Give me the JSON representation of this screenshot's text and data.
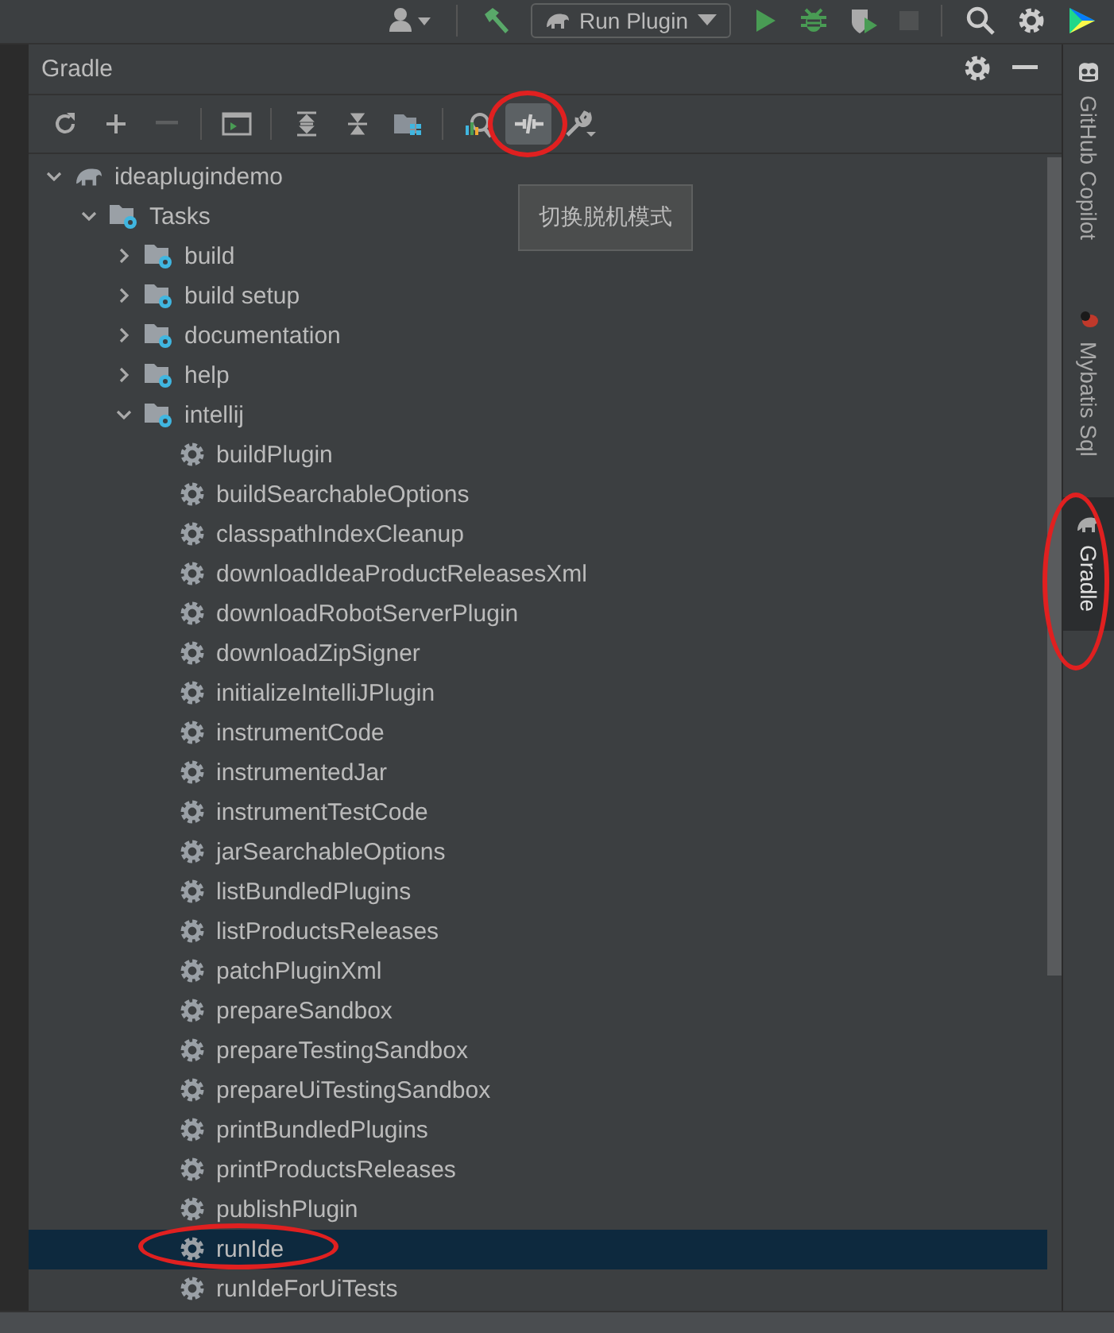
{
  "top_toolbar": {
    "run_configuration": "Run Plugin",
    "buttons": [
      {
        "kind": "user",
        "disabled": false
      },
      {
        "kind": "hammer",
        "disabled": false
      },
      {
        "kind": "config",
        "disabled": false
      },
      {
        "kind": "run",
        "disabled": false
      },
      {
        "kind": "debug",
        "disabled": false
      },
      {
        "kind": "coverage",
        "disabled": false
      },
      {
        "kind": "stop",
        "disabled": true
      },
      {
        "kind": "search",
        "disabled": false
      },
      {
        "kind": "settings",
        "disabled": false
      },
      {
        "kind": "logo",
        "disabled": false
      }
    ]
  },
  "panel": {
    "title": "Gradle",
    "toolbar": [
      {
        "kind": "refresh",
        "disabled": false,
        "selected": false,
        "circled": false
      },
      {
        "kind": "add",
        "disabled": false,
        "selected": false,
        "circled": false
      },
      {
        "kind": "remove",
        "disabled": true,
        "selected": false,
        "circled": false
      },
      {
        "kind": "terminal",
        "disabled": false,
        "selected": false,
        "circled": false
      },
      {
        "kind": "expand",
        "disabled": false,
        "selected": false,
        "circled": false
      },
      {
        "kind": "collapse",
        "disabled": false,
        "selected": false,
        "circled": false
      },
      {
        "kind": "folders",
        "disabled": false,
        "selected": false,
        "circled": false
      },
      {
        "kind": "analyze",
        "disabled": false,
        "selected": false,
        "circled": false
      },
      {
        "kind": "offline",
        "disabled": false,
        "selected": true,
        "circled": true
      },
      {
        "kind": "wrench",
        "disabled": false,
        "selected": false,
        "circled": false
      }
    ],
    "tooltip": "切换脱机模式",
    "tree": [
      {
        "label": "ideaplugindemo",
        "kind": "project",
        "expanded": true,
        "selected": false,
        "circled": false,
        "children": [
          {
            "label": "Tasks",
            "kind": "folder",
            "expanded": true,
            "selected": false,
            "circled": false,
            "children": [
              {
                "label": "build",
                "kind": "folder",
                "expanded": false,
                "selected": false,
                "circled": false
              },
              {
                "label": "build setup",
                "kind": "folder",
                "expanded": false,
                "selected": false,
                "circled": false
              },
              {
                "label": "documentation",
                "kind": "folder",
                "expanded": false,
                "selected": false,
                "circled": false
              },
              {
                "label": "help",
                "kind": "folder",
                "expanded": false,
                "selected": false,
                "circled": false
              },
              {
                "label": "intellij",
                "kind": "folder",
                "expanded": true,
                "selected": false,
                "circled": false,
                "children": [
                  {
                    "label": "buildPlugin",
                    "kind": "task",
                    "selected": false,
                    "circled": false
                  },
                  {
                    "label": "buildSearchableOptions",
                    "kind": "task",
                    "selected": false,
                    "circled": false
                  },
                  {
                    "label": "classpathIndexCleanup",
                    "kind": "task",
                    "selected": false,
                    "circled": false
                  },
                  {
                    "label": "downloadIdeaProductReleasesXml",
                    "kind": "task",
                    "selected": false,
                    "circled": false
                  },
                  {
                    "label": "downloadRobotServerPlugin",
                    "kind": "task",
                    "selected": false,
                    "circled": false
                  },
                  {
                    "label": "downloadZipSigner",
                    "kind": "task",
                    "selected": false,
                    "circled": false
                  },
                  {
                    "label": "initializeIntelliJPlugin",
                    "kind": "task",
                    "selected": false,
                    "circled": false
                  },
                  {
                    "label": "instrumentCode",
                    "kind": "task",
                    "selected": false,
                    "circled": false
                  },
                  {
                    "label": "instrumentedJar",
                    "kind": "task",
                    "selected": false,
                    "circled": false
                  },
                  {
                    "label": "instrumentTestCode",
                    "kind": "task",
                    "selected": false,
                    "circled": false
                  },
                  {
                    "label": "jarSearchableOptions",
                    "kind": "task",
                    "selected": false,
                    "circled": false
                  },
                  {
                    "label": "listBundledPlugins",
                    "kind": "task",
                    "selected": false,
                    "circled": false
                  },
                  {
                    "label": "listProductsReleases",
                    "kind": "task",
                    "selected": false,
                    "circled": false
                  },
                  {
                    "label": "patchPluginXml",
                    "kind": "task",
                    "selected": false,
                    "circled": false
                  },
                  {
                    "label": "prepareSandbox",
                    "kind": "task",
                    "selected": false,
                    "circled": false
                  },
                  {
                    "label": "prepareTestingSandbox",
                    "kind": "task",
                    "selected": false,
                    "circled": false
                  },
                  {
                    "label": "prepareUiTestingSandbox",
                    "kind": "task",
                    "selected": false,
                    "circled": false
                  },
                  {
                    "label": "printBundledPlugins",
                    "kind": "task",
                    "selected": false,
                    "circled": false
                  },
                  {
                    "label": "printProductsReleases",
                    "kind": "task",
                    "selected": false,
                    "circled": false
                  },
                  {
                    "label": "publishPlugin",
                    "kind": "task",
                    "selected": false,
                    "circled": false
                  },
                  {
                    "label": "runIde",
                    "kind": "task",
                    "selected": true,
                    "circled": true
                  },
                  {
                    "label": "runIdeForUiTests",
                    "kind": "task",
                    "selected": false,
                    "circled": false
                  }
                ]
              }
            ]
          }
        ]
      }
    ]
  },
  "side_tabs": [
    {
      "label": "GitHub Copilot",
      "kind": "copilot",
      "selected": false,
      "circled": false
    },
    {
      "label": "Mybatis Sql",
      "kind": "mybatis",
      "selected": false,
      "circled": false
    },
    {
      "label": "Gradle",
      "kind": "gradle",
      "selected": true,
      "circled": true
    }
  ]
}
